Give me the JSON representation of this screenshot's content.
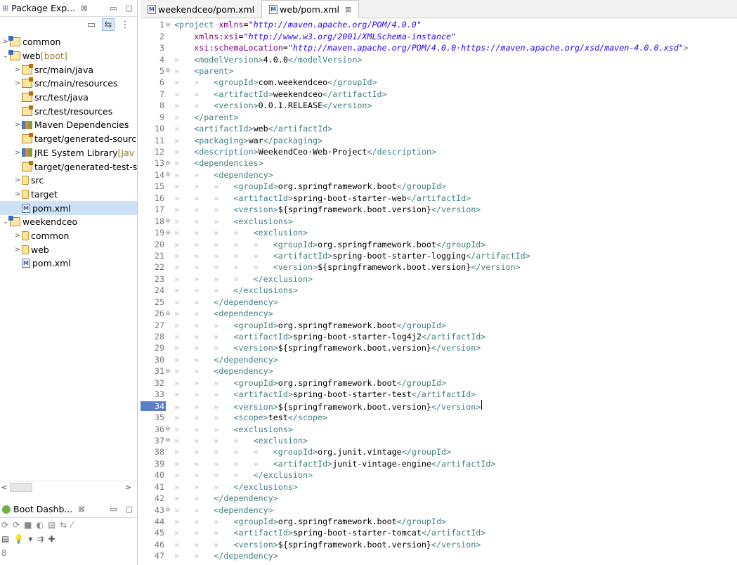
{
  "left_panel": {
    "package_explorer": {
      "title": "Package Exp...",
      "close": "⊠",
      "minimize": "▭",
      "maximize": "▢"
    },
    "toolbar": [
      {
        "icon": "collapse-all-icon",
        "glyph": "▭"
      },
      {
        "icon": "link-with-editor-icon",
        "glyph": "⇆"
      },
      {
        "icon": "view-menu-icon",
        "glyph": "⋮"
      }
    ],
    "tree": [
      {
        "indent": 0,
        "twisty": ">",
        "icon": "proj",
        "label": "common",
        "deco": ""
      },
      {
        "indent": 0,
        "twisty": "⌄",
        "icon": "proj",
        "label": "web",
        "deco": " [boot]"
      },
      {
        "indent": 1,
        "twisty": ">",
        "icon": "pkg",
        "label": "src/main/java",
        "deco": ""
      },
      {
        "indent": 1,
        "twisty": ">",
        "icon": "pkg",
        "label": "src/main/resources",
        "deco": ""
      },
      {
        "indent": 1,
        "twisty": "",
        "icon": "pkg",
        "label": "src/test/java",
        "deco": ""
      },
      {
        "indent": 1,
        "twisty": "",
        "icon": "pkg",
        "label": "src/test/resources",
        "deco": ""
      },
      {
        "indent": 1,
        "twisty": ">",
        "icon": "lib",
        "label": "Maven Dependencies",
        "deco": ""
      },
      {
        "indent": 1,
        "twisty": "",
        "icon": "pkg",
        "label": "target/generated-sourc",
        "deco": ""
      },
      {
        "indent": 1,
        "twisty": ">",
        "icon": "lib",
        "label": "JRE System Library",
        "deco": " [Jav"
      },
      {
        "indent": 1,
        "twisty": "",
        "icon": "pkg",
        "label": "target/generated-test-s",
        "deco": ""
      },
      {
        "indent": 1,
        "twisty": ">",
        "icon": "fold",
        "label": "src",
        "deco": ""
      },
      {
        "indent": 1,
        "twisty": ">",
        "icon": "fold",
        "label": "target",
        "deco": ""
      },
      {
        "indent": 1,
        "twisty": "",
        "icon": "xml",
        "label": "pom.xml",
        "deco": "",
        "selected": true
      },
      {
        "indent": 0,
        "twisty": "⌄",
        "icon": "proj",
        "label": "weekendceo",
        "deco": ""
      },
      {
        "indent": 1,
        "twisty": ">",
        "icon": "fold",
        "label": "common",
        "deco": ""
      },
      {
        "indent": 1,
        "twisty": ">",
        "icon": "fold",
        "label": "web",
        "deco": ""
      },
      {
        "indent": 1,
        "twisty": "",
        "icon": "xml",
        "label": "pom.xml",
        "deco": ""
      }
    ],
    "scroll": {
      "left": "<",
      "right": ">"
    },
    "boot_dashboard": {
      "title": "Boot Dashb...",
      "close": "⊠",
      "minimize": "▭",
      "maximize": "▢",
      "toolbar1": [
        "⟳",
        "⟳",
        "■",
        "◐",
        "▤",
        "⇆",
        "⁄"
      ],
      "toolbar2": [
        "▤",
        "💡",
        "▾",
        "⇉",
        "✚"
      ],
      "more": "8"
    }
  },
  "editor": {
    "tabs": [
      {
        "label": "weekendceo/pom.xml",
        "active": false
      },
      {
        "label": "web/pom.xml",
        "active": true,
        "close": "⊠"
      }
    ],
    "current_line": 34,
    "lines": [
      {
        "n": "1",
        "f": "⊖",
        "ind": 0,
        "code": [
          [
            "t",
            "<project"
          ],
          [
            "ws",
            "·"
          ],
          [
            "a",
            "xmlns"
          ],
          [
            "p",
            "="
          ],
          [
            "v",
            "\"http://maven.apache.org/POM/4.0.0\""
          ]
        ]
      },
      {
        "n": "2",
        "f": "",
        "ind": 0,
        "code": [
          [
            "p",
            "    "
          ],
          [
            "a",
            "xmlns:xsi"
          ],
          [
            "p",
            "="
          ],
          [
            "v",
            "\"http://www.w3.org/2001/XMLSchema-instance\""
          ]
        ]
      },
      {
        "n": "3",
        "f": "",
        "ind": 0,
        "code": [
          [
            "p",
            "    "
          ],
          [
            "a",
            "xsi:schemaLocation"
          ],
          [
            "p",
            "="
          ],
          [
            "v",
            "\"http://maven.apache.org/POM/4.0.0·https://maven.apache.org/xsd/maven-4.0.0.xsd\""
          ],
          [
            "t",
            ">"
          ]
        ]
      },
      {
        "n": "4",
        "f": "",
        "ind": 1,
        "code": [
          [
            "t",
            "<modelVersion>"
          ],
          [
            "p",
            "4.0.0"
          ],
          [
            "t",
            "</modelVersion>"
          ]
        ]
      },
      {
        "n": "5",
        "f": "⊖",
        "ind": 1,
        "code": [
          [
            "t",
            "<parent>"
          ]
        ]
      },
      {
        "n": "6",
        "f": "",
        "ind": 2,
        "code": [
          [
            "t",
            "<groupId>"
          ],
          [
            "p",
            "com.weekendceo"
          ],
          [
            "t",
            "</groupId>"
          ]
        ]
      },
      {
        "n": "7",
        "f": "",
        "ind": 2,
        "code": [
          [
            "t",
            "<artifactId>"
          ],
          [
            "p",
            "weekendceo"
          ],
          [
            "t",
            "</artifactId>"
          ]
        ]
      },
      {
        "n": "8",
        "f": "",
        "ind": 2,
        "code": [
          [
            "t",
            "<version>"
          ],
          [
            "p",
            "0.0.1.RELEASE"
          ],
          [
            "t",
            "</version>"
          ]
        ]
      },
      {
        "n": "9",
        "f": "",
        "ind": 1,
        "code": [
          [
            "t",
            "</parent>"
          ]
        ]
      },
      {
        "n": "10",
        "f": "",
        "ind": 1,
        "code": [
          [
            "t",
            "<artifactId>"
          ],
          [
            "p",
            "web"
          ],
          [
            "t",
            "</artifactId>"
          ]
        ]
      },
      {
        "n": "11",
        "f": "",
        "ind": 1,
        "code": [
          [
            "t",
            "<packaging>"
          ],
          [
            "p",
            "war"
          ],
          [
            "t",
            "</packaging>"
          ]
        ]
      },
      {
        "n": "12",
        "f": "",
        "ind": 1,
        "code": [
          [
            "t",
            "<description>"
          ],
          [
            "p",
            "WeekendCeo·Web·Project"
          ],
          [
            "t",
            "</description>"
          ]
        ]
      },
      {
        "n": "13",
        "f": "⊖",
        "ind": 1,
        "code": [
          [
            "t",
            "<dependencies>"
          ]
        ]
      },
      {
        "n": "14",
        "f": "⊖",
        "ind": 2,
        "code": [
          [
            "t",
            "<dependency>"
          ]
        ]
      },
      {
        "n": "15",
        "f": "",
        "ind": 3,
        "code": [
          [
            "t",
            "<groupId>"
          ],
          [
            "p",
            "org.springframework.boot"
          ],
          [
            "t",
            "</groupId>"
          ]
        ]
      },
      {
        "n": "16",
        "f": "",
        "ind": 3,
        "code": [
          [
            "t",
            "<artifactId>"
          ],
          [
            "p",
            "spring-boot-starter-web"
          ],
          [
            "t",
            "</artifactId>"
          ]
        ]
      },
      {
        "n": "17",
        "f": "",
        "ind": 3,
        "code": [
          [
            "t",
            "<version>"
          ],
          [
            "p",
            "${springframework.boot.version}"
          ],
          [
            "t",
            "</version>"
          ]
        ]
      },
      {
        "n": "18",
        "f": "⊖",
        "ind": 3,
        "code": [
          [
            "t",
            "<exclusions>"
          ]
        ]
      },
      {
        "n": "19",
        "f": "⊖",
        "ind": 4,
        "code": [
          [
            "t",
            "<exclusion>"
          ]
        ]
      },
      {
        "n": "20",
        "f": "",
        "ind": 5,
        "code": [
          [
            "t",
            "<groupId>"
          ],
          [
            "p",
            "org.springframework.boot"
          ],
          [
            "t",
            "</groupId>"
          ]
        ]
      },
      {
        "n": "21",
        "f": "",
        "ind": 5,
        "code": [
          [
            "t",
            "<artifactId>"
          ],
          [
            "p",
            "spring-boot-starter-logging"
          ],
          [
            "t",
            "</artifactId>"
          ]
        ]
      },
      {
        "n": "22",
        "f": "",
        "ind": 5,
        "code": [
          [
            "t",
            "<version>"
          ],
          [
            "p",
            "${springframework.boot.version}"
          ],
          [
            "t",
            "</version>"
          ]
        ]
      },
      {
        "n": "23",
        "f": "",
        "ind": 4,
        "code": [
          [
            "t",
            "</exclusion>"
          ]
        ]
      },
      {
        "n": "24",
        "f": "",
        "ind": 3,
        "code": [
          [
            "t",
            "</exclusions>"
          ]
        ]
      },
      {
        "n": "25",
        "f": "",
        "ind": 2,
        "code": [
          [
            "t",
            "</dependency>"
          ]
        ]
      },
      {
        "n": "26",
        "f": "⊖",
        "ind": 2,
        "code": [
          [
            "t",
            "<dependency>"
          ]
        ]
      },
      {
        "n": "27",
        "f": "",
        "ind": 3,
        "code": [
          [
            "t",
            "<groupId>"
          ],
          [
            "p",
            "org.springframework.boot"
          ],
          [
            "t",
            "</groupId>"
          ]
        ]
      },
      {
        "n": "28",
        "f": "",
        "ind": 3,
        "code": [
          [
            "t",
            "<artifactId>"
          ],
          [
            "p",
            "spring-boot-starter-log4j2"
          ],
          [
            "t",
            "</artifactId>"
          ]
        ]
      },
      {
        "n": "29",
        "f": "",
        "ind": 3,
        "code": [
          [
            "t",
            "<version>"
          ],
          [
            "p",
            "${springframework.boot.version}"
          ],
          [
            "t",
            "</version>"
          ]
        ]
      },
      {
        "n": "30",
        "f": "",
        "ind": 2,
        "code": [
          [
            "t",
            "</dependency>"
          ]
        ]
      },
      {
        "n": "31",
        "f": "⊖",
        "ind": 2,
        "code": [
          [
            "t",
            "<dependency>"
          ]
        ]
      },
      {
        "n": "32",
        "f": "",
        "ind": 3,
        "code": [
          [
            "t",
            "<groupId>"
          ],
          [
            "p",
            "org.springframework.boot"
          ],
          [
            "t",
            "</groupId>"
          ]
        ]
      },
      {
        "n": "33",
        "f": "",
        "ind": 3,
        "code": [
          [
            "t",
            "<artifactId>"
          ],
          [
            "p",
            "spring-boot-starter-test"
          ],
          [
            "t",
            "</artifactId>"
          ]
        ]
      },
      {
        "n": "34",
        "f": "",
        "ind": 3,
        "code": [
          [
            "t",
            "<version>"
          ],
          [
            "p",
            "${springframework.boot.version}"
          ],
          [
            "t",
            "</version>"
          ]
        ],
        "cursor": true
      },
      {
        "n": "35",
        "f": "",
        "ind": 3,
        "code": [
          [
            "t",
            "<scope>"
          ],
          [
            "p",
            "test"
          ],
          [
            "t",
            "</scope>"
          ]
        ]
      },
      {
        "n": "36",
        "f": "⊖",
        "ind": 3,
        "code": [
          [
            "t",
            "<exclusions>"
          ]
        ]
      },
      {
        "n": "37",
        "f": "⊖",
        "ind": 4,
        "code": [
          [
            "t",
            "<exclusion>"
          ]
        ]
      },
      {
        "n": "38",
        "f": "",
        "ind": 5,
        "code": [
          [
            "t",
            "<groupId>"
          ],
          [
            "p",
            "org.junit.vintage"
          ],
          [
            "t",
            "</groupId>"
          ]
        ]
      },
      {
        "n": "39",
        "f": "",
        "ind": 5,
        "code": [
          [
            "t",
            "<artifactId>"
          ],
          [
            "p",
            "junit-vintage-engine"
          ],
          [
            "t",
            "</artifactId>"
          ]
        ]
      },
      {
        "n": "40",
        "f": "",
        "ind": 4,
        "code": [
          [
            "t",
            "</exclusion>"
          ]
        ]
      },
      {
        "n": "41",
        "f": "",
        "ind": 3,
        "code": [
          [
            "t",
            "</exclusions>"
          ]
        ]
      },
      {
        "n": "42",
        "f": "",
        "ind": 2,
        "code": [
          [
            "t",
            "</dependency>"
          ]
        ]
      },
      {
        "n": "43",
        "f": "⊖",
        "ind": 2,
        "code": [
          [
            "t",
            "<dependency>"
          ]
        ]
      },
      {
        "n": "44",
        "f": "",
        "ind": 3,
        "code": [
          [
            "t",
            "<groupId>"
          ],
          [
            "p",
            "org.springframework.boot"
          ],
          [
            "t",
            "</groupId>"
          ]
        ]
      },
      {
        "n": "45",
        "f": "",
        "ind": 3,
        "code": [
          [
            "t",
            "<artifactId>"
          ],
          [
            "p",
            "spring-boot-starter-tomcat"
          ],
          [
            "t",
            "</artifactId>"
          ]
        ]
      },
      {
        "n": "46",
        "f": "",
        "ind": 3,
        "code": [
          [
            "t",
            "<version>"
          ],
          [
            "p",
            "${springframework.boot.version}"
          ],
          [
            "t",
            "</version>"
          ]
        ]
      },
      {
        "n": "47",
        "f": "",
        "ind": 2,
        "code": [
          [
            "t",
            "</dependency>"
          ]
        ]
      }
    ]
  },
  "colors": {
    "tag": "#3f7f7f",
    "attr": "#7f007f",
    "string": "#2a00ff",
    "selection": "#cde1f7",
    "gutter_highlight": "#5b7fc7"
  }
}
